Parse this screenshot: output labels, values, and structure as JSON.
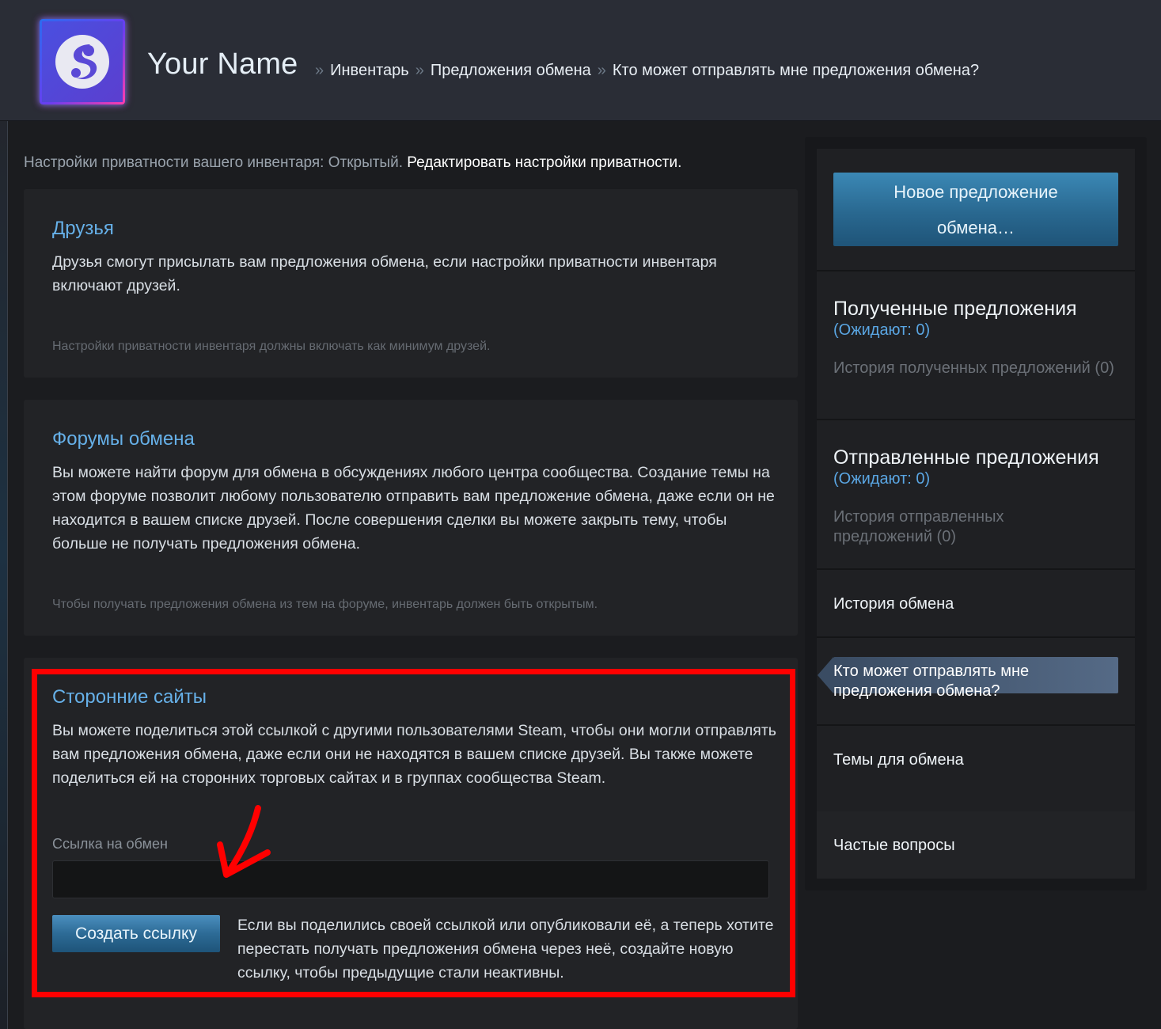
{
  "header": {
    "user_name": "Your Name",
    "breadcrumb_sep": "»",
    "crumbs": [
      "Инвентарь",
      "Предложения обмена",
      "Кто может отправлять мне предложения обмена?"
    ]
  },
  "privacy": {
    "label": "Настройки приватности вашего инвентаря: Открытый.",
    "edit_link": "Редактировать настройки приватности."
  },
  "friends": {
    "title": "Друзья",
    "text": "Друзья смогут присылать вам предложения обмена, если настройки приватности инвентаря включают друзей.",
    "note": "Настройки приватности инвентаря должны включать как минимум друзей."
  },
  "forums": {
    "title": "Форумы обмена",
    "text": "Вы можете найти форум для обмена в обсуждениях любого центра сообщества. Создание темы на этом форуме позволит любому пользователю отправить вам предложение обмена, даже если он не находится в вашем списке друзей. После совершения сделки вы можете закрыть тему, чтобы больше не получать предложения обмена.",
    "note": "Чтобы получать предложения обмена из тем на форуме, инвентарь должен быть открытым."
  },
  "third_party": {
    "title": "Сторонние сайты",
    "text": "Вы можете поделиться этой ссылкой с другими пользователями Steam, чтобы они могли отправлять вам предложения обмена, даже если они не находятся в вашем списке друзей. Вы также можете поделиться ей на сторонних торговых сайтах и в группах сообщества Steam.",
    "link_label": "Ссылка на обмен",
    "link_value": "",
    "create_button": "Создать ссылку",
    "create_note": "Если вы поделились своей ссылкой или опубликовали её, а теперь хотите перестать получать предложения обмена через неё, создайте новую ссылку, чтобы предыдущие стали неактивны."
  },
  "sidebar": {
    "new_offer_line1": "Новое предложение",
    "new_offer_line2": "обмена…",
    "received_title": "Полученные предложения",
    "received_pending": "(Ожидают: 0)",
    "received_history": "История полученных предложений (0)",
    "sent_title": "Отправленные предложения",
    "sent_pending": "(Ожидают: 0)",
    "sent_history": "История отправленных предложений (0)",
    "trade_history": "История обмена",
    "who_can_send": "Кто может отправлять мне предложения обмена?",
    "trade_topics": "Темы для обмена",
    "faq": "Частые вопросы"
  },
  "colors": {
    "accent_blue": "#66b0e8",
    "highlight_red": "#ff0000",
    "button_blue": "#2d6b96"
  },
  "icons": {
    "avatar": "steam-logo-avatar",
    "annotation": "red-arrow-icon"
  }
}
